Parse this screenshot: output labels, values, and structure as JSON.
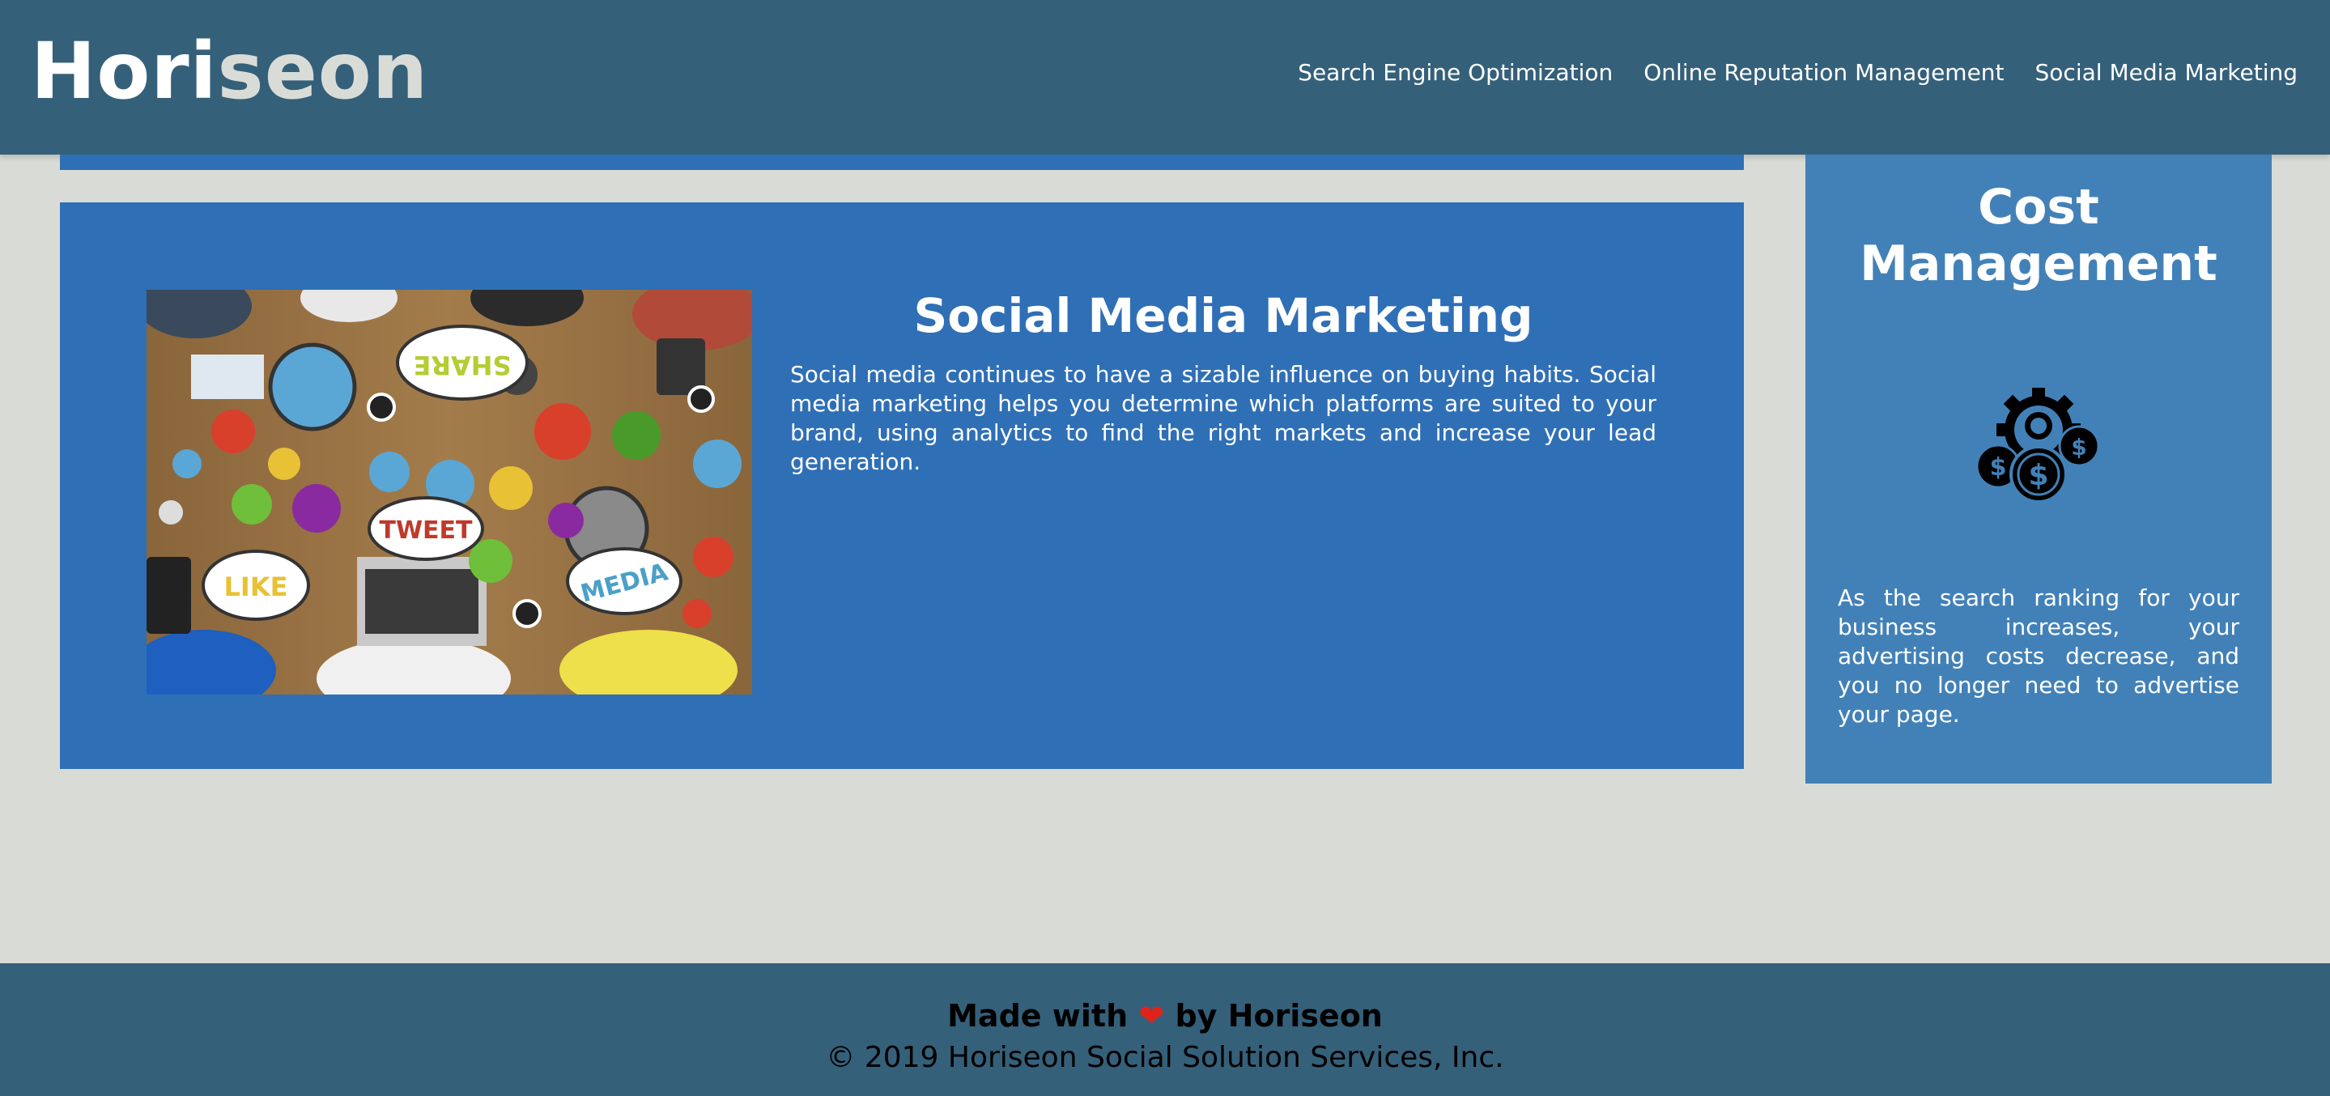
{
  "header": {
    "logo_main": "Hori",
    "logo_accent": "seon",
    "nav": [
      {
        "label": "Search Engine Optimization"
      },
      {
        "label": "Online Reputation Management"
      },
      {
        "label": "Social Media Marketing"
      }
    ]
  },
  "main": {
    "card": {
      "title": "Social Media Marketing",
      "text": "Social media continues to have a sizable influence on buying habits. Social media marketing helps you determine which platforms are suited to your brand, using analytics to find the right markets and increase your lead generation.",
      "image_icon_labels": [
        "SHARE",
        "TWEET",
        "LIKE",
        "MEDIA"
      ]
    }
  },
  "aside": {
    "title": "Cost Management",
    "icon": "cost-management-icon",
    "text": "As the search ranking for your business increases, your advertising costs decrease, and you no longer need to advertise your page."
  },
  "footer": {
    "made_prefix": "Made with",
    "made_heart": "❤",
    "made_suffix": "by Horiseon",
    "copyright": "© 2019 Horiseon Social Solution Services, Inc."
  },
  "colors": {
    "header_bg": "#35607a",
    "page_bg": "#d9dcd6",
    "card_bg": "#2f6fb6",
    "aside_bg": "#4281b8",
    "heart": "#e0231a"
  }
}
